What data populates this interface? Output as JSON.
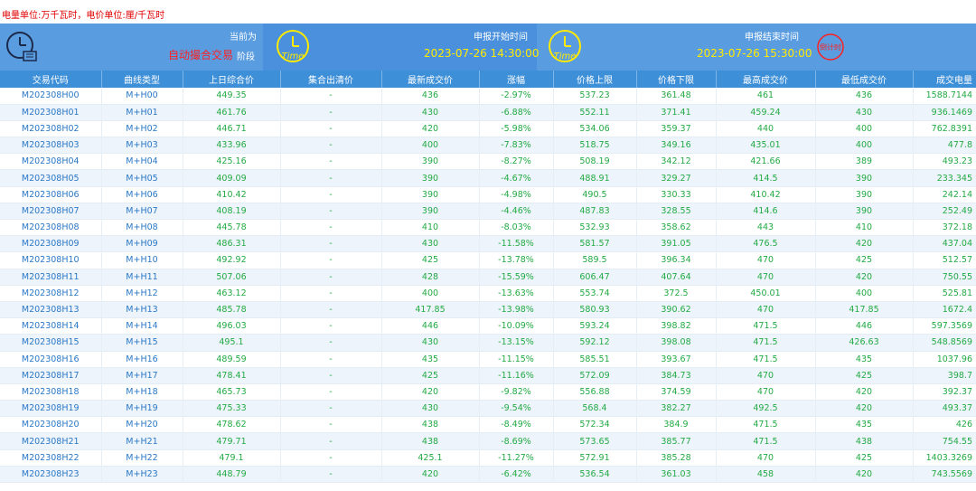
{
  "unit_note": "电量单位:万千瓦时，电价单位:厘/千瓦时",
  "panels": {
    "current": {
      "label": "当前为",
      "value": "自动撮合交易",
      "stage": "阶段"
    },
    "start": {
      "label": "申报开始时间",
      "value": "2023-07-26 14:30:00",
      "icon_text": "Time"
    },
    "end": {
      "label": "申报结束时间",
      "value": "2023-07-26 15:30:00",
      "icon_text": "Time",
      "countdown_text": "倒计时"
    }
  },
  "colors": {
    "header_bg": "#3d8fd8",
    "info_bg": "#5a9ce0",
    "value_green": "#22aa44",
    "code_blue": "#2a78c6",
    "alert_red": "#ff2020",
    "time_yellow": "#ffea00"
  },
  "table": {
    "columns": [
      "交易代码",
      "曲线类型",
      "上日综合价",
      "集合出清价",
      "最新成交价",
      "涨幅",
      "价格上限",
      "价格下限",
      "最高成交价",
      "最低成交价",
      "成交电量"
    ],
    "rows": [
      [
        "M202308H00",
        "M+H00",
        "449.35",
        "-",
        "436",
        "-2.97%",
        "537.23",
        "361.48",
        "461",
        "436",
        "1588.7144"
      ],
      [
        "M202308H01",
        "M+H01",
        "461.76",
        "-",
        "430",
        "-6.88%",
        "552.11",
        "371.41",
        "459.24",
        "430",
        "936.1469"
      ],
      [
        "M202308H02",
        "M+H02",
        "446.71",
        "-",
        "420",
        "-5.98%",
        "534.06",
        "359.37",
        "440",
        "400",
        "762.8391"
      ],
      [
        "M202308H03",
        "M+H03",
        "433.96",
        "-",
        "400",
        "-7.83%",
        "518.75",
        "349.16",
        "435.01",
        "400",
        "477.8"
      ],
      [
        "M202308H04",
        "M+H04",
        "425.16",
        "-",
        "390",
        "-8.27%",
        "508.19",
        "342.12",
        "421.66",
        "389",
        "493.23"
      ],
      [
        "M202308H05",
        "M+H05",
        "409.09",
        "-",
        "390",
        "-4.67%",
        "488.91",
        "329.27",
        "414.5",
        "390",
        "233.345"
      ],
      [
        "M202308H06",
        "M+H06",
        "410.42",
        "-",
        "390",
        "-4.98%",
        "490.5",
        "330.33",
        "410.42",
        "390",
        "242.14"
      ],
      [
        "M202308H07",
        "M+H07",
        "408.19",
        "-",
        "390",
        "-4.46%",
        "487.83",
        "328.55",
        "414.6",
        "390",
        "252.49"
      ],
      [
        "M202308H08",
        "M+H08",
        "445.78",
        "-",
        "410",
        "-8.03%",
        "532.93",
        "358.62",
        "443",
        "410",
        "372.18"
      ],
      [
        "M202308H09",
        "M+H09",
        "486.31",
        "-",
        "430",
        "-11.58%",
        "581.57",
        "391.05",
        "476.5",
        "420",
        "437.04"
      ],
      [
        "M202308H10",
        "M+H10",
        "492.92",
        "-",
        "425",
        "-13.78%",
        "589.5",
        "396.34",
        "470",
        "425",
        "512.57"
      ],
      [
        "M202308H11",
        "M+H11",
        "507.06",
        "-",
        "428",
        "-15.59%",
        "606.47",
        "407.64",
        "470",
        "420",
        "750.55"
      ],
      [
        "M202308H12",
        "M+H12",
        "463.12",
        "-",
        "400",
        "-13.63%",
        "553.74",
        "372.5",
        "450.01",
        "400",
        "525.81"
      ],
      [
        "M202308H13",
        "M+H13",
        "485.78",
        "-",
        "417.85",
        "-13.98%",
        "580.93",
        "390.62",
        "470",
        "417.85",
        "1672.4"
      ],
      [
        "M202308H14",
        "M+H14",
        "496.03",
        "-",
        "446",
        "-10.09%",
        "593.24",
        "398.82",
        "471.5",
        "446",
        "597.3569"
      ],
      [
        "M202308H15",
        "M+H15",
        "495.1",
        "-",
        "430",
        "-13.15%",
        "592.12",
        "398.08",
        "471.5",
        "426.63",
        "548.8569"
      ],
      [
        "M202308H16",
        "M+H16",
        "489.59",
        "-",
        "435",
        "-11.15%",
        "585.51",
        "393.67",
        "471.5",
        "435",
        "1037.96"
      ],
      [
        "M202308H17",
        "M+H17",
        "478.41",
        "-",
        "425",
        "-11.16%",
        "572.09",
        "384.73",
        "470",
        "425",
        "398.7"
      ],
      [
        "M202308H18",
        "M+H18",
        "465.73",
        "-",
        "420",
        "-9.82%",
        "556.88",
        "374.59",
        "470",
        "420",
        "392.37"
      ],
      [
        "M202308H19",
        "M+H19",
        "475.33",
        "-",
        "430",
        "-9.54%",
        "568.4",
        "382.27",
        "492.5",
        "420",
        "493.37"
      ],
      [
        "M202308H20",
        "M+H20",
        "478.62",
        "-",
        "438",
        "-8.49%",
        "572.34",
        "384.9",
        "471.5",
        "435",
        "426"
      ],
      [
        "M202308H21",
        "M+H21",
        "479.71",
        "-",
        "438",
        "-8.69%",
        "573.65",
        "385.77",
        "471.5",
        "438",
        "754.55"
      ],
      [
        "M202308H22",
        "M+H22",
        "479.1",
        "-",
        "425.1",
        "-11.27%",
        "572.91",
        "385.28",
        "470",
        "425",
        "1403.3269"
      ],
      [
        "M202308H23",
        "M+H23",
        "448.79",
        "-",
        "420",
        "-6.42%",
        "536.54",
        "361.03",
        "458",
        "420",
        "743.5569"
      ]
    ]
  }
}
